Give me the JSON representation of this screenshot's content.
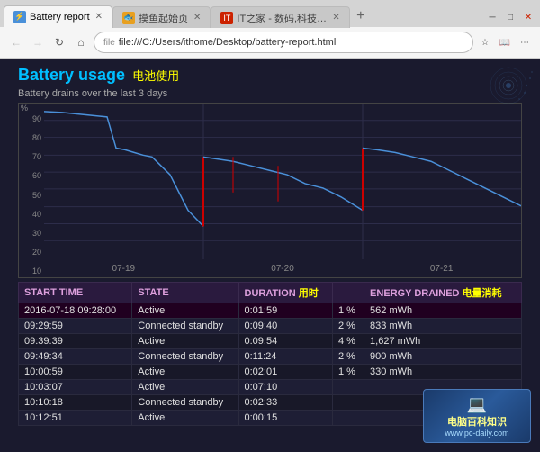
{
  "browser": {
    "tabs": [
      {
        "id": "tab1",
        "label": "Battery report",
        "active": true,
        "favicon": "battery"
      },
      {
        "id": "tab2",
        "label": "摸鱼起始页",
        "active": false,
        "favicon": "fish"
      },
      {
        "id": "tab3",
        "label": "IT之家 - 数码,科技,生...",
        "active": false,
        "favicon": "it"
      }
    ],
    "url": "file:///C:/Users/ithome/Desktop/battery-report.html",
    "nav": {
      "back_disabled": false,
      "forward_disabled": false
    }
  },
  "page": {
    "title_en": "Battery usage",
    "title_zh": "电池使用",
    "subtitle": "Battery drains over the last 3 days",
    "y_axis_label": "%",
    "y_labels": [
      "90",
      "80",
      "70",
      "60",
      "50",
      "40",
      "30",
      "20",
      "10"
    ],
    "x_labels": [
      "07-19",
      "07-20",
      "07-21"
    ],
    "chart": {
      "line_color": "#00bfff",
      "drop_color": "#cc0000"
    },
    "table": {
      "headers": [
        {
          "en": "START TIME",
          "zh": null
        },
        {
          "en": "STATE",
          "zh": null
        },
        {
          "en": "DURATION",
          "zh": "用时"
        },
        {
          "en": "ENERGY DRAINED",
          "zh": "电量消耗"
        }
      ],
      "rows": [
        [
          "2016-07-18 09:28:00",
          "Active",
          "0:01:59",
          "1 %",
          "562 mWh"
        ],
        [
          "09:29:59",
          "Connected standby",
          "0:09:40",
          "2 %",
          "833 mWh"
        ],
        [
          "09:39:39",
          "Active",
          "0:09:54",
          "4 %",
          "1,627 mWh"
        ],
        [
          "09:49:34",
          "Connected standby",
          "0:11:24",
          "2 %",
          "900 mWh"
        ],
        [
          "10:00:59",
          "Active",
          "0:02:01",
          "1 %",
          "330 mWh"
        ],
        [
          "10:03:07",
          "Active",
          "0:07:10",
          "",
          ""
        ],
        [
          "10:10:18",
          "Connected standby",
          "0:02:33",
          "",
          ""
        ],
        [
          "10:12:51",
          "Active",
          "0:00:15",
          "",
          ""
        ]
      ]
    }
  },
  "watermark": {
    "title": "电脑百科知识",
    "url": "www.pc-daily.com"
  }
}
